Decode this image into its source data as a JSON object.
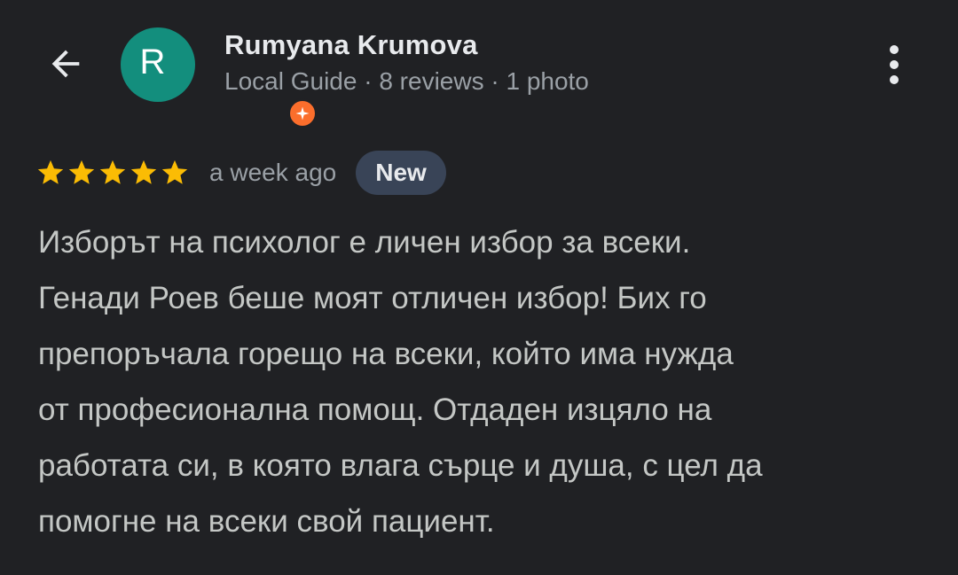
{
  "header": {
    "back_icon": "arrow-back-icon",
    "avatar": {
      "letter": "R",
      "color": "#138e7d",
      "badge_icon": "local-guide-icon",
      "badge_color": "#fb6e2c"
    },
    "user_name": "Rumyana Krumova",
    "user_meta": "Local Guide · 8 reviews · 1 photo",
    "more_icon": "more-vert-icon"
  },
  "review": {
    "rating": 5,
    "max_rating": 5,
    "star_icon": "star-icon",
    "star_color": "#fbbc04",
    "date": "a week ago",
    "badge": "New",
    "text": "Изборът на психолог е личен избор за всеки.\nГенади Роев беше моят отличен избор! Бих го\nпрепоръчала горещо на всеки, който има нужда\nот професионална помощ. Отдаден изцяло на\nработата си, в която влага сърце и душа, с цел да\nпомогне на всеки свой пациент."
  }
}
